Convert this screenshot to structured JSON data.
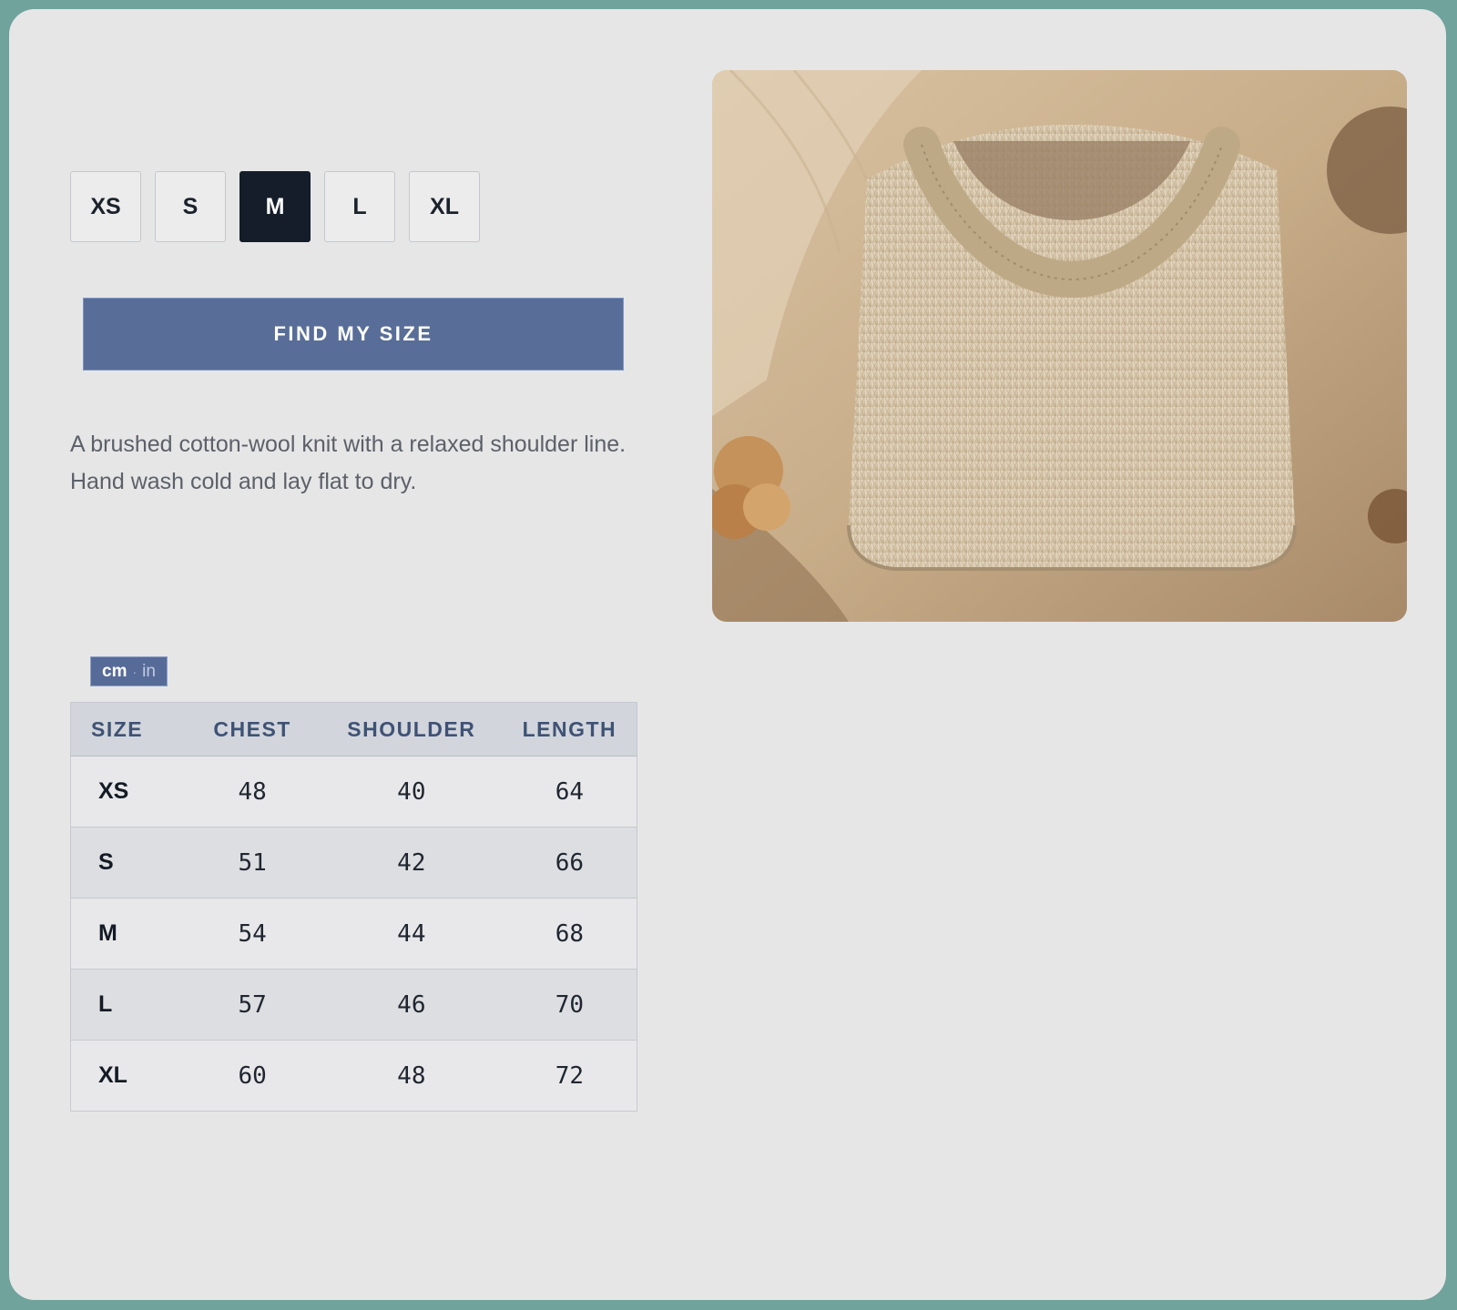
{
  "sizes": {
    "options": [
      "XS",
      "S",
      "M",
      "L",
      "XL"
    ],
    "selected": "M"
  },
  "cta": {
    "label": "FIND MY SIZE"
  },
  "description": "A brushed cotton-wool knit with a relaxed shoulder line. Hand wash cold and lay flat to dry.",
  "product_image": {
    "subject": "folded knit sweater"
  },
  "units": {
    "active": "cm",
    "separator": "·",
    "inactive": "in"
  },
  "size_chart": {
    "headers": [
      "SIZE",
      "CHEST",
      "SHOULDER",
      "LENGTH"
    ],
    "rows": [
      [
        "XS",
        "48",
        "40",
        "64"
      ],
      [
        "S",
        "51",
        "42",
        "66"
      ],
      [
        "M",
        "54",
        "44",
        "68"
      ],
      [
        "L",
        "57",
        "46",
        "70"
      ],
      [
        "XL",
        "60",
        "48",
        "72"
      ]
    ]
  },
  "colors": {
    "accent": "#586d97",
    "selected": "#141d29",
    "background": "#e6e6e7",
    "frame": "#6fa39c"
  }
}
